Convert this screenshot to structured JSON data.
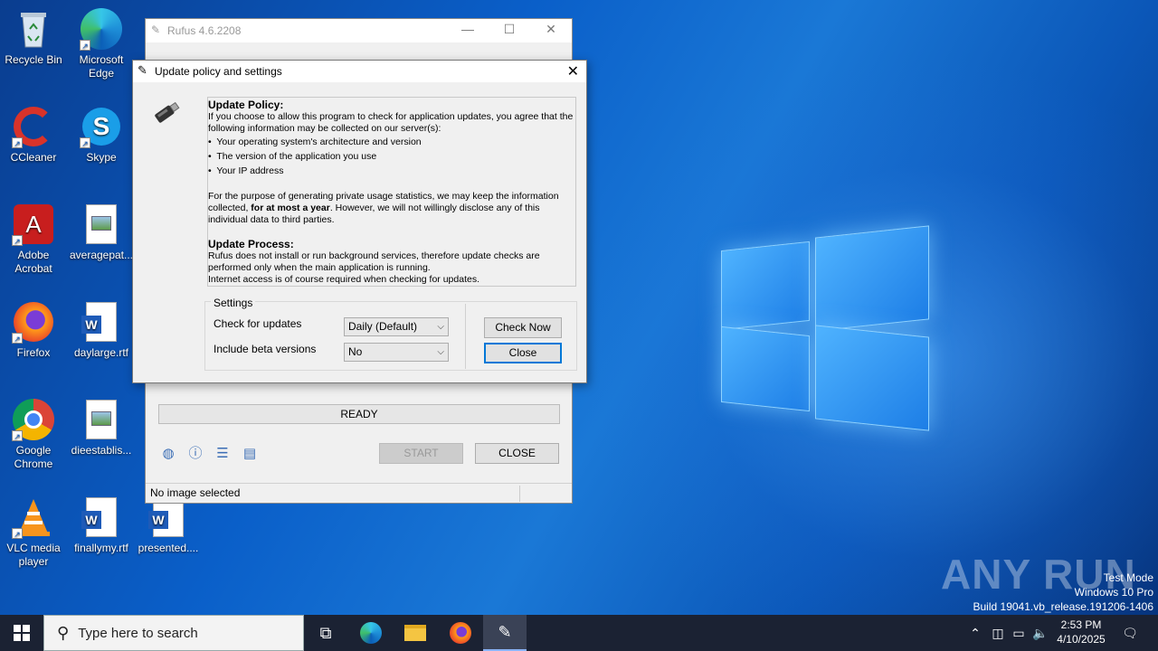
{
  "desktop": {
    "icons": [
      {
        "label": "Recycle Bin",
        "icon": "recycle-bin-icon"
      },
      {
        "label": "Microsoft Edge",
        "icon": "edge-icon"
      },
      {
        "label": "CCleaner",
        "icon": "ccleaner-icon"
      },
      {
        "label": "Skype",
        "icon": "skype-icon"
      },
      {
        "label": "Adobe Acrobat",
        "icon": "acrobat-icon"
      },
      {
        "label": "averagepat...",
        "icon": "image-file-icon"
      },
      {
        "label": "Firefox",
        "icon": "firefox-icon"
      },
      {
        "label": "daylarge.rtf",
        "icon": "word-doc-icon"
      },
      {
        "label": "Google Chrome",
        "icon": "chrome-icon"
      },
      {
        "label": "dieestablis...",
        "icon": "image-file-icon"
      },
      {
        "label": "VLC media player",
        "icon": "vlc-icon"
      },
      {
        "label": "finallymy.rtf",
        "icon": "word-doc-icon"
      },
      {
        "label": "presented....",
        "icon": "word-doc-icon"
      }
    ],
    "watermark": {
      "line1": "Test Mode",
      "line2": "Windows 10 Pro",
      "line3": "Build 19041.vb_release.191206-1406",
      "brand": "ANY RUN"
    }
  },
  "rufus": {
    "title": "Rufus 4.6.2208",
    "status": "READY",
    "start_label": "START",
    "close_label": "CLOSE",
    "bottom_status": "No image selected"
  },
  "dialog": {
    "title": "Update policy and settings",
    "policy_heading": "Update Policy:",
    "policy_intro": "If you choose to allow this program to check for application updates, you agree that the following information may be collected on our server(s):",
    "bullets": [
      "Your operating system's architecture and version",
      "The version of the application you use",
      "Your IP address"
    ],
    "privacy_pre": "For the purpose of generating private usage statistics, we may keep the information collected, ",
    "privacy_bold": "for at most a year",
    "privacy_post": ". However, we will not willingly disclose any of this individual data to third parties.",
    "process_heading": "Update Process:",
    "process_text_1": "Rufus does not install or run background services, therefore update checks are performed only when the main application is running.",
    "process_text_2": "Internet access is of course required when checking for updates.",
    "settings_legend": "Settings",
    "check_label": "Check for updates",
    "check_value": "Daily (Default)",
    "beta_label": "Include beta versions",
    "beta_value": "No",
    "check_now_label": "Check Now",
    "close_label": "Close"
  },
  "taskbar": {
    "search_placeholder": "Type here to search",
    "time": "2:53 PM",
    "date": "4/10/2025"
  }
}
